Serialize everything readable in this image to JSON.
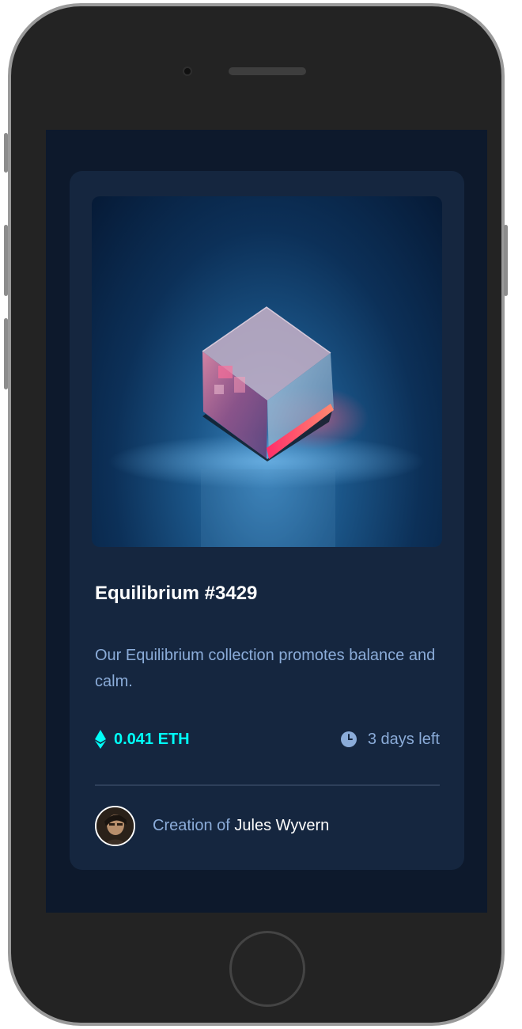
{
  "card": {
    "title": "Equilibrium #3429",
    "description": "Our Equilibrium collection promotes balance and calm.",
    "price": "0.041 ETH",
    "time_left": "3 days left",
    "creator_prefix": "Creation of",
    "creator_name": "Jules Wyvern"
  },
  "icons": {
    "price": "ethereum-icon",
    "time": "clock-icon"
  },
  "colors": {
    "background": "#0d192c",
    "card": "#15263f",
    "accent_cyan": "#00fff8",
    "soft_blue": "#8bacd9",
    "white": "#ffffff",
    "divider": "#2e405a"
  }
}
